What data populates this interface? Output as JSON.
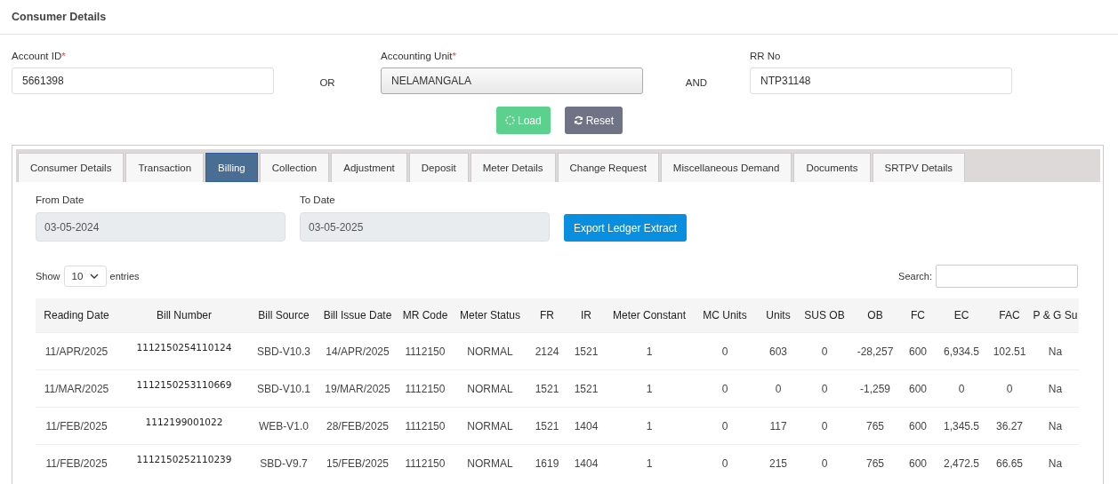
{
  "page_title": "Consumer Details",
  "search_fields": [
    {
      "label": "Account ID",
      "required_mark": "*",
      "value": "5661398",
      "kind": "text"
    },
    {
      "connector": "OR",
      "label": "Accounting Unit",
      "required_mark": "*",
      "value": "NELAMANGALA",
      "kind": "select"
    },
    {
      "connector": "AND",
      "label": "RR No",
      "value": "NTP31148",
      "kind": "text"
    }
  ],
  "buttons": [
    {
      "label": "Load",
      "kind": "load"
    },
    {
      "label": "Reset",
      "kind": "reset"
    }
  ],
  "tabs": [
    {
      "label": "Consumer Details",
      "selected": false
    },
    {
      "label": "Transaction",
      "selected": false
    },
    {
      "label": "Billing",
      "selected": true
    },
    {
      "label": "Collection",
      "selected": false
    },
    {
      "label": "Adjustment",
      "selected": false
    },
    {
      "label": "Deposit",
      "selected": false
    },
    {
      "label": "Meter Details",
      "selected": false
    },
    {
      "label": "Change Request",
      "selected": false
    },
    {
      "label": "Miscellaneous Demand",
      "selected": false
    },
    {
      "label": "Documents",
      "selected": false
    },
    {
      "label": "SRTPV Details",
      "selected": false
    }
  ],
  "date_fields": [
    {
      "label": "From Date",
      "value": "03-05-2024"
    },
    {
      "label": "To Date",
      "value": "03-05-2025"
    }
  ],
  "export_button": "Export Ledger Extract",
  "table_controls": {
    "show_label": "Show",
    "page_size": "10",
    "entries_label": "entries",
    "search_label": "Search:"
  },
  "table": {
    "columns": [
      "Reading Date",
      "Bill Number",
      "Bill Source",
      "Bill Issue Date",
      "MR Code",
      "Meter Status",
      "FR",
      "IR",
      "Meter Constant",
      "MC Units",
      "Units",
      "SUS OB",
      "OB",
      "FC",
      "EC",
      "FAC",
      "P & G Su"
    ],
    "rows": [
      [
        "11/APR/2025",
        "1112150254110124",
        "SBD-V10.3",
        "14/APR/2025",
        "1112150",
        "NORMAL",
        "2124",
        "1521",
        "1",
        "0",
        "603",
        "0",
        "-28,257",
        "600",
        "6,934.5",
        "102.51",
        "Na"
      ],
      [
        "11/MAR/2025",
        "1112150253110669",
        "SBD-V10.1",
        "19/MAR/2025",
        "1112150",
        "NORMAL",
        "1521",
        "1521",
        "1",
        "0",
        "0",
        "0",
        "-1,259",
        "600",
        "0",
        "0",
        "Na"
      ],
      [
        "11/FEB/2025",
        "1112199001022",
        "WEB-V1.0",
        "28/FEB/2025",
        "1112150",
        "NORMAL",
        "1521",
        "1404",
        "1",
        "0",
        "117",
        "0",
        "765",
        "600",
        "1,345.5",
        "36.27",
        "Na"
      ],
      [
        "11/FEB/2025",
        "1112150252110239",
        "SBD-V9.7",
        "15/FEB/2025",
        "1112150",
        "NORMAL",
        "1619",
        "1404",
        "1",
        "0",
        "215",
        "0",
        "765",
        "600",
        "2,472.5",
        "66.65",
        "Na"
      ]
    ]
  }
}
